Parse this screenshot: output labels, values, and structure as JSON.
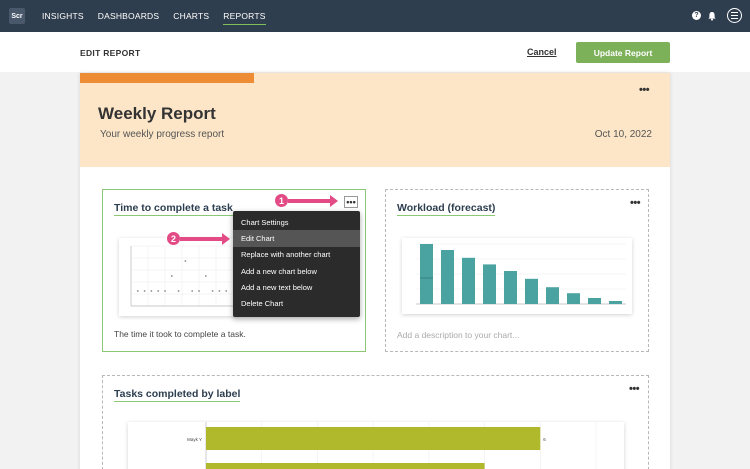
{
  "topbar": {
    "logo_text": "Scr",
    "nav": [
      "INSIGHTS",
      "DASHBOARDS",
      "CHARTS",
      "REPORTS"
    ],
    "active": "REPORTS",
    "help_icon": "?",
    "bell_icon": "bell-icon",
    "menu_icon": "hamburger-menu-icon"
  },
  "subheader": {
    "title": "EDIT REPORT",
    "cancel_label": "Cancel",
    "update_label": "Update Report",
    "update_color": "#7cb15a"
  },
  "report": {
    "title": "Weekly Report",
    "subtitle": "Your weekly progress report",
    "date": "Oct 10, 2022",
    "header_bg": "#fce6c7",
    "accent_color": "#ee8c35"
  },
  "cards": {
    "time_card": {
      "title": "Time to complete a task",
      "description": "The time it took to complete a task."
    },
    "workload_card": {
      "title": "Workload (forecast)",
      "description_placeholder": "Add a description to your chart..."
    },
    "labels_card": {
      "title": "Tasks completed by label",
      "first_label": "Mayk Y",
      "first_value": "6"
    }
  },
  "context_menu": {
    "items": [
      "Chart Settings",
      "Edit Chart",
      "Replace with another chart",
      "Add a new chart below",
      "Add a new text below",
      "Delete Chart"
    ],
    "highlighted": "Edit Chart"
  },
  "annotations": {
    "step1": "1",
    "step2": "2",
    "color": "#e24b85"
  },
  "chart_data": [
    {
      "type": "scatter",
      "title": "",
      "x": [
        1,
        2,
        3,
        4,
        5,
        6,
        7,
        8,
        9,
        10,
        11,
        12,
        13,
        14
      ],
      "y": [
        1,
        1,
        1,
        1,
        1,
        2,
        1,
        3,
        1,
        1,
        2,
        1,
        1,
        1
      ]
    },
    {
      "type": "bar",
      "title": "",
      "categories": [
        "1",
        "2",
        "3",
        "4",
        "5",
        "6",
        "7",
        "8",
        "9",
        "10"
      ],
      "values": [
        1.0,
        0.9,
        0.77,
        0.66,
        0.55,
        0.42,
        0.28,
        0.18,
        0.1,
        0.05
      ],
      "color": "#4aa3a1"
    },
    {
      "type": "bar",
      "title": "",
      "orientation": "horizontal",
      "categories": [
        "Mayk Y",
        ""
      ],
      "values": [
        6,
        5
      ],
      "color": "#b0b82c"
    }
  ]
}
